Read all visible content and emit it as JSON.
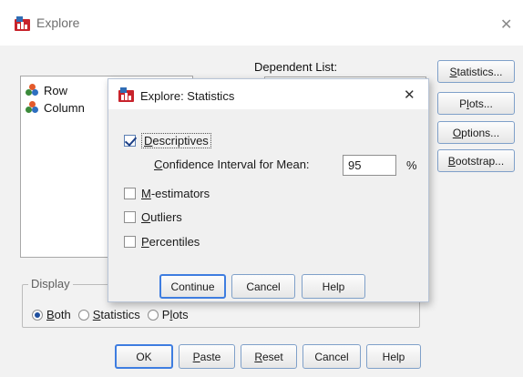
{
  "main_window": {
    "title": "Explore",
    "dependent_list_label": "Dependent List:",
    "variables": [
      {
        "label": "Row"
      },
      {
        "label": "Column"
      }
    ],
    "side_buttons": [
      {
        "pre": "",
        "ul": "S",
        "post": "tatistics..."
      },
      {
        "pre": "P",
        "ul": "l",
        "post": "ots..."
      },
      {
        "pre": "",
        "ul": "O",
        "post": "ptions..."
      },
      {
        "pre": "",
        "ul": "B",
        "post": "ootstrap..."
      }
    ],
    "display": {
      "legend": "Display",
      "options": [
        {
          "pre": "",
          "ul": "B",
          "post": "oth",
          "selected": true
        },
        {
          "pre": "",
          "ul": "S",
          "post": "tatistics",
          "selected": false
        },
        {
          "pre": "P",
          "ul": "l",
          "post": "ots",
          "selected": false
        }
      ]
    },
    "bottom_buttons": {
      "ok": "OK",
      "paste": {
        "ul": "P",
        "post": "aste"
      },
      "reset": {
        "ul": "R",
        "post": "eset"
      },
      "cancel": "Cancel",
      "help": "Help"
    }
  },
  "dialog": {
    "title": "Explore: Statistics",
    "descriptives": {
      "ul": "D",
      "post": "escriptives",
      "checked": true
    },
    "ci_label": {
      "ul": "C",
      "post": "onfidence Interval for Mean:"
    },
    "ci_value": "95",
    "ci_unit": "%",
    "options": [
      {
        "ul": "M",
        "post": "-estimators",
        "checked": false
      },
      {
        "ul": "O",
        "post": "utliers",
        "checked": false
      },
      {
        "ul": "P",
        "post": "ercentiles",
        "checked": false
      }
    ],
    "buttons": {
      "continue": "Continue",
      "cancel": "Cancel",
      "help": "Help"
    }
  },
  "colors": {
    "accent_border": "#3e7de0",
    "button_border": "#7fa0c9",
    "check_mark": "#1c3f86",
    "app_icon_red": "#c8232c",
    "app_icon_blue": "#2f6db5"
  }
}
